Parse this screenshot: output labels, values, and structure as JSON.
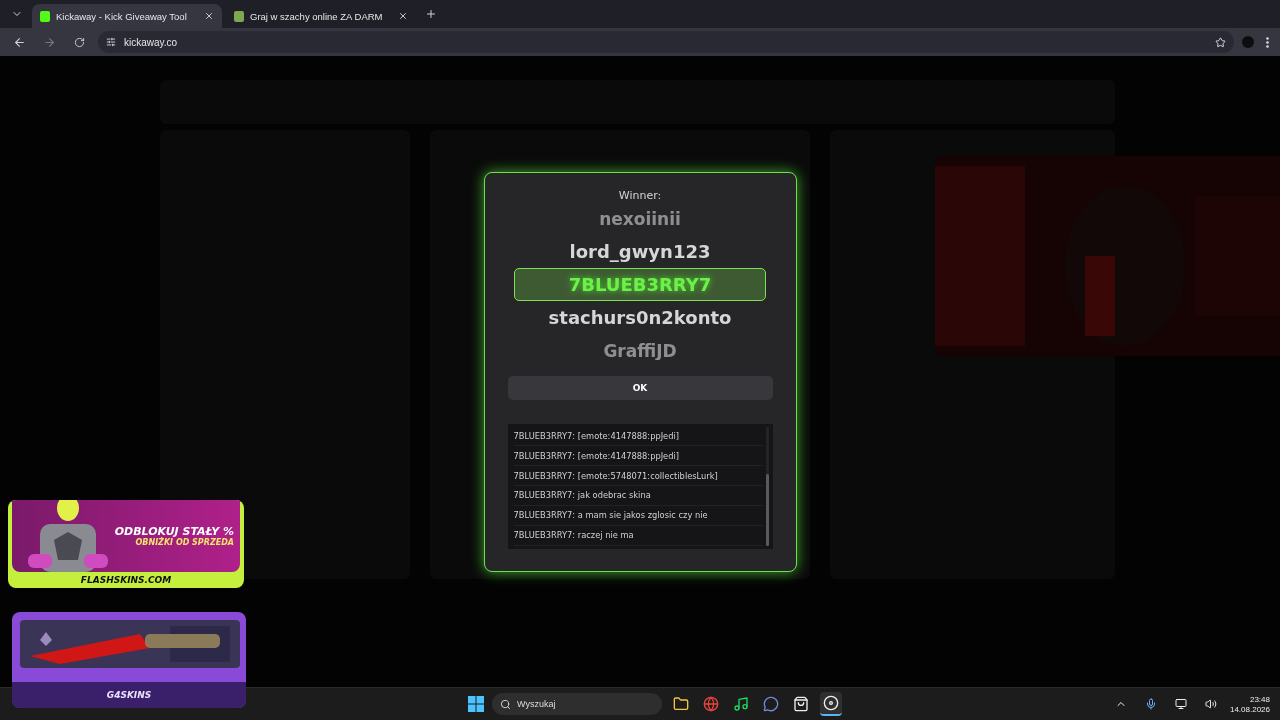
{
  "browser": {
    "tabs": [
      {
        "title": "Kickaway - Kick Giveaway Tool",
        "selected": true
      },
      {
        "title": "Graj w szachy online ZA DARM",
        "selected": false
      }
    ],
    "url": "kickaway.co"
  },
  "modal": {
    "heading": "Winner:",
    "names": [
      {
        "name": "nexoiinii",
        "selected": false
      },
      {
        "name": "lord_gwyn123",
        "selected": false
      },
      {
        "name": "7BLUEB3RRY7",
        "selected": true
      },
      {
        "name": "stachurs0n2konto",
        "selected": false
      },
      {
        "name": "GraffiJD",
        "selected": false
      }
    ],
    "ok_button": "OK",
    "chat": [
      "7BLUEB3RRY7: [emote:4147888:ppJedi]",
      "7BLUEB3RRY7: [emote:4147888:ppJedi]",
      "7BLUEB3RRY7: [emote:5748071:collectiblesLurk]",
      "7BLUEB3RRY7: jak odebrac skina",
      "7BLUEB3RRY7: a mam sie jakos zglosic czy nie",
      "7BLUEB3RRY7: raczej nie ma"
    ]
  },
  "promos": [
    {
      "kind": "flash",
      "headline": "ODBLOKUJ STAŁY %",
      "subline": "OBNIŻKI OD SPRZEDA",
      "brand": "FLASHSKINS.COM"
    },
    {
      "kind": "knife",
      "brand": "G4SKINS"
    }
  ],
  "taskbar": {
    "search": "Wyszukaj",
    "time": "23:48",
    "date": "14.08.2026"
  }
}
